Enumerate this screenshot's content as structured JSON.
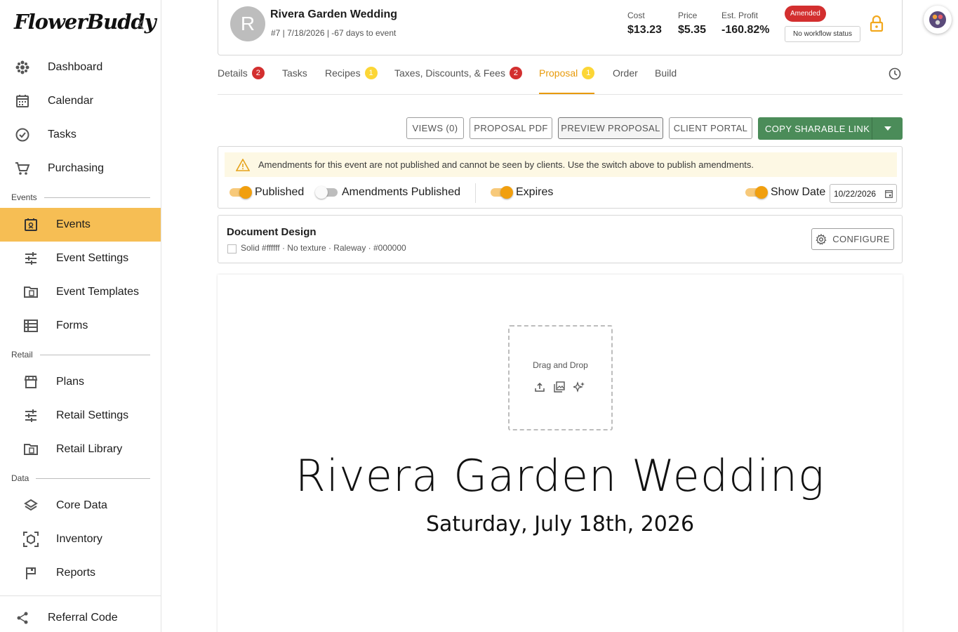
{
  "brand": {
    "logo_text": "FlowerBuddy"
  },
  "sidebar": {
    "top_items": [
      {
        "label": "Dashboard",
        "icon": "dashboard-icon"
      },
      {
        "label": "Calendar",
        "icon": "calendar-icon"
      },
      {
        "label": "Tasks",
        "icon": "check-circle-icon"
      },
      {
        "label": "Purchasing",
        "icon": "cart-icon"
      }
    ],
    "sections": [
      {
        "title": "Events",
        "items": [
          {
            "label": "Events",
            "active": true
          },
          {
            "label": "Event Settings"
          },
          {
            "label": "Event Templates"
          },
          {
            "label": "Forms"
          }
        ]
      },
      {
        "title": "Retail",
        "items": [
          {
            "label": "Plans"
          },
          {
            "label": "Retail Settings"
          },
          {
            "label": "Retail Library"
          }
        ]
      },
      {
        "title": "Data",
        "items": [
          {
            "label": "Core Data"
          },
          {
            "label": "Inventory"
          },
          {
            "label": "Reports"
          }
        ]
      }
    ],
    "footer_item": {
      "label": "Referral Code",
      "icon": "share-icon"
    }
  },
  "event": {
    "avatar_letter": "R",
    "title": "Rivera Garden Wedding",
    "subtitle": "#7 | 7/18/2026 | -67 days to event",
    "stats": [
      {
        "label": "Cost",
        "value": "$13.23"
      },
      {
        "label": "Price",
        "value": "$5.35"
      },
      {
        "label": "Est. Profit",
        "value": "-160.82%"
      }
    ],
    "status_badge": "Amended",
    "workflow_status": "No workflow status"
  },
  "tabs": [
    {
      "label": "Details",
      "badge": "2",
      "badge_color": "red"
    },
    {
      "label": "Tasks"
    },
    {
      "label": "Recipes",
      "badge": "1",
      "badge_color": "yellow"
    },
    {
      "label": "Taxes, Discounts, & Fees",
      "badge": "2",
      "badge_color": "red"
    },
    {
      "label": "Proposal",
      "badge": "1",
      "badge_color": "yellow",
      "active": true
    },
    {
      "label": "Order"
    },
    {
      "label": "Build"
    }
  ],
  "actions": {
    "views": "VIEWS (0)",
    "proposal_pdf": "PROPOSAL PDF",
    "preview_proposal": "PREVIEW PROPOSAL",
    "client_portal": "CLIENT PORTAL",
    "copy_link": "COPY SHARABLE LINK"
  },
  "publish": {
    "warning": "Amendments for this event are not published and cannot be seen by clients. Use the switch above to publish amendments.",
    "toggles": [
      {
        "label": "Published",
        "on": true
      },
      {
        "label": "Amendments Published",
        "on": false
      },
      {
        "label": "Expires",
        "on": true
      },
      {
        "label": "Show Date",
        "on": true
      }
    ],
    "expire_date": "10/22/2026"
  },
  "design": {
    "title": "Document Design",
    "meta": "Solid #ffffff · No texture · Raleway · #000000",
    "configure_label": "CONFIGURE"
  },
  "proposal_preview": {
    "dropzone_text": "Drag and Drop",
    "title": "Rivera Garden Wedding",
    "date": "Saturday, July 18th, 2026"
  },
  "colors": {
    "accent": "#f6be54",
    "active_tab": "#e89a0a",
    "primary_button": "#4b8c59",
    "danger": "#d32f2f"
  }
}
